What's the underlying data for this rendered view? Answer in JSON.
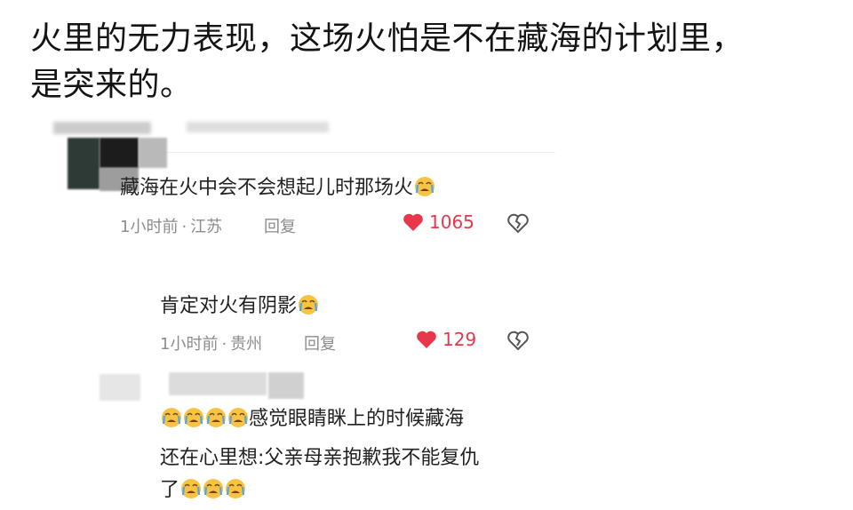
{
  "post": {
    "line1": "火里的无力表现，这场火怕是不在藏海的计划里，",
    "line2": "是突来的。"
  },
  "comments": [
    {
      "text": "藏海在火中会不会想起儿时那场火",
      "time": "1小时前",
      "location": "江苏",
      "reply_label": "回复",
      "likes": "1065",
      "emoji": "crying-emoji"
    },
    {
      "text": "肯定对火有阴影",
      "time": "1小时前",
      "location": "贵州",
      "reply_label": "回复",
      "likes": "129",
      "emoji": "crying-emoji"
    },
    {
      "line1": "感觉眼睛眯上的时候藏海",
      "line2": "还在心里想:父亲母亲抱歉我不能复仇",
      "line3": "了",
      "emoji": "crying-emoji"
    }
  ],
  "meta_separator": "·",
  "colors": {
    "heart": "#e8364b",
    "meta": "#8c8c8c",
    "emoji_face": "#f6c343"
  }
}
